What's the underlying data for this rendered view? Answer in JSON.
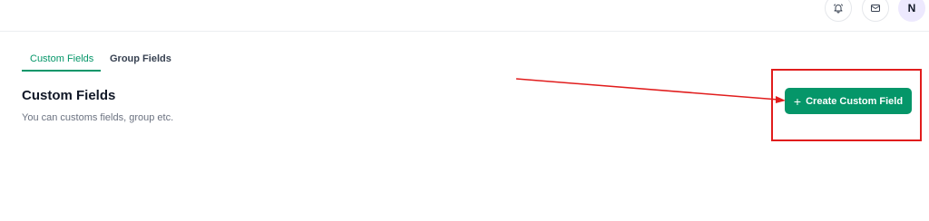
{
  "header": {
    "bell_icon": "bell-icon",
    "mail_icon": "mail-icon",
    "avatar_initial": "N"
  },
  "tabs": [
    {
      "label": "Custom Fields",
      "active": true
    },
    {
      "label": "Group Fields",
      "active": false
    }
  ],
  "main": {
    "title": "Custom Fields",
    "subtitle": "You can customs fields, group etc.",
    "create_button_label": "Create Custom Field",
    "create_button_icon": "plus-icon"
  },
  "annotation": {
    "color": "#e11d1d",
    "shapes": [
      "highlight-box",
      "arrow"
    ]
  },
  "colors": {
    "accent": "#059669",
    "avatar_bg": "#ede9fe"
  }
}
